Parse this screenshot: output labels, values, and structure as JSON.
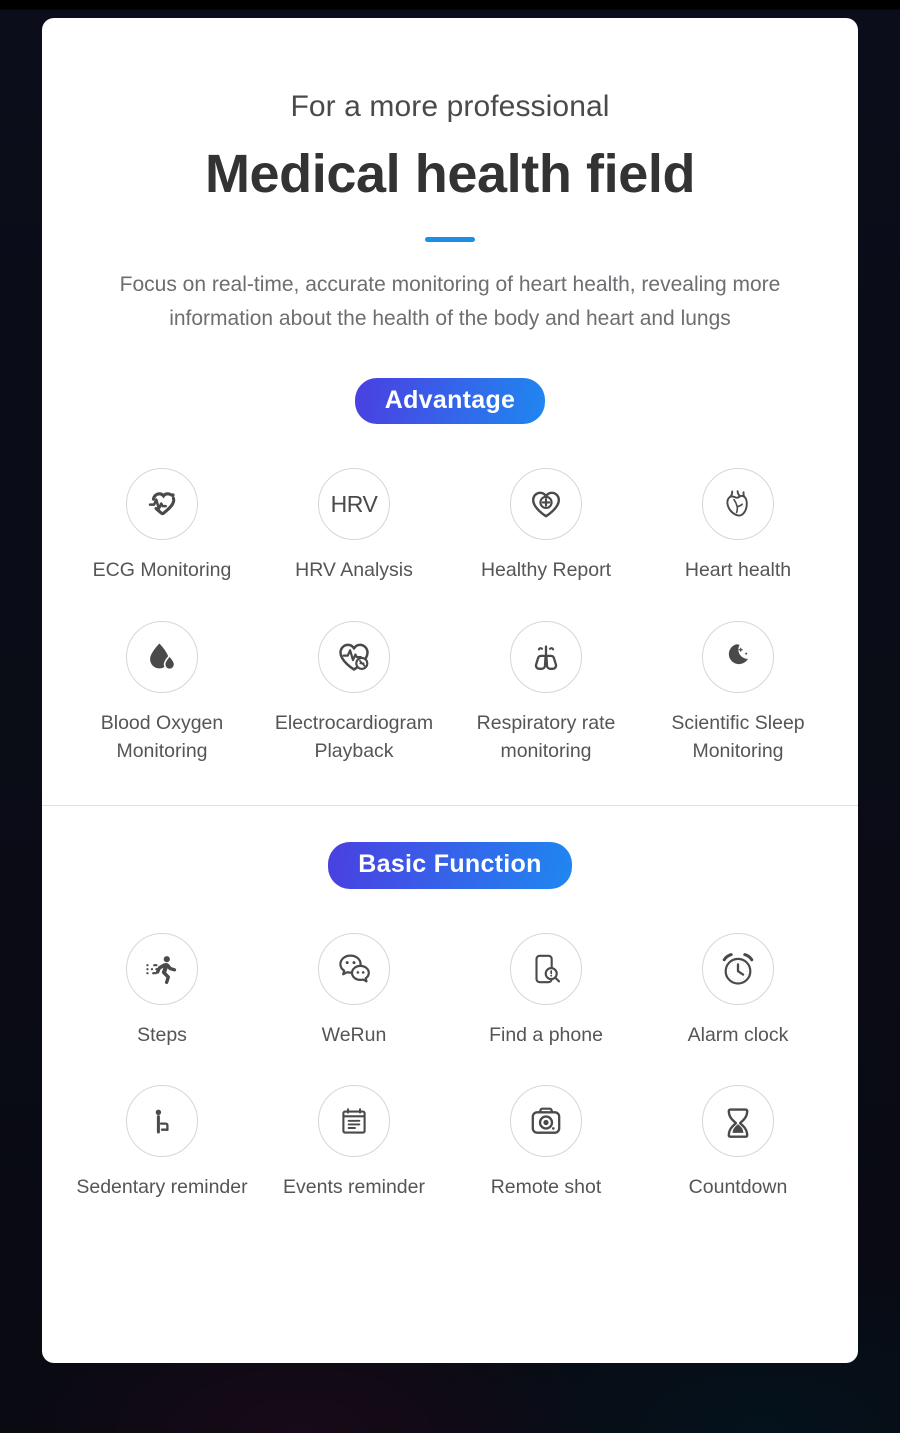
{
  "background": {
    "color": "#0a0b14",
    "card_color": "#ffffff"
  },
  "header": {
    "eyebrow": "For a more professional",
    "title": "Medical health field",
    "accent_color": "#1890e8",
    "subtitle": "Focus on real-time, accurate monitoring of heart health, revealing more information about the health of the body and heart and lungs"
  },
  "sections": [
    {
      "badge": "Advantage",
      "badge_gradient_from": "#4a3fe0",
      "badge_gradient_to": "#1f87f0",
      "features": [
        {
          "icon": "ecg-heart-icon",
          "label": "ECG Monitoring"
        },
        {
          "icon": "hrv-text-icon",
          "label": "HRV Analysis",
          "icon_text": "HRV"
        },
        {
          "icon": "heart-plus-icon",
          "label": "Healthy Report"
        },
        {
          "icon": "anatomical-heart-icon",
          "label": "Heart health"
        },
        {
          "icon": "blood-drop-icon",
          "label": "Blood Oxygen Monitoring"
        },
        {
          "icon": "heart-pulse-playback-icon",
          "label": "Electrocardiogram Playback"
        },
        {
          "icon": "lungs-icon",
          "label": "Respiratory rate monitoring"
        },
        {
          "icon": "moon-stars-icon",
          "label": "Scientific Sleep Monitoring"
        }
      ]
    },
    {
      "badge": "Basic Function",
      "badge_gradient_from": "#4a3fe0",
      "badge_gradient_to": "#1f87f0",
      "features": [
        {
          "icon": "running-person-icon",
          "label": "Steps"
        },
        {
          "icon": "chat-bubbles-icon",
          "label": "WeRun"
        },
        {
          "icon": "phone-search-icon",
          "label": "Find a phone"
        },
        {
          "icon": "alarm-clock-icon",
          "label": "Alarm clock"
        },
        {
          "icon": "sitting-person-icon",
          "label": "Sedentary reminder"
        },
        {
          "icon": "calendar-note-icon",
          "label": "Events reminder"
        },
        {
          "icon": "camera-icon",
          "label": "Remote shot"
        },
        {
          "icon": "hourglass-icon",
          "label": "Countdown"
        }
      ]
    }
  ]
}
